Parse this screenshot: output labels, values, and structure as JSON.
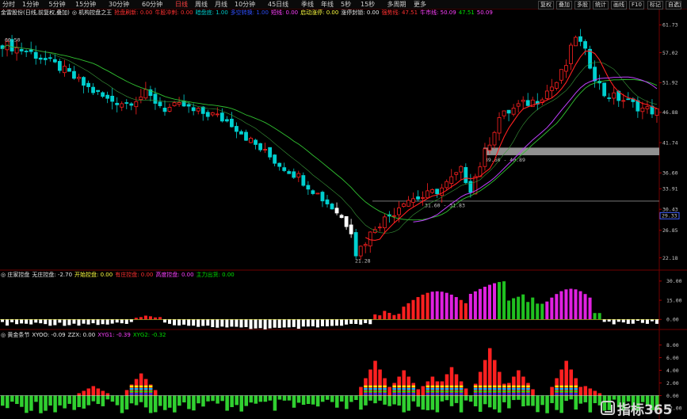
{
  "toolbar": {
    "periods": [
      "分时",
      "1分钟",
      "5分钟",
      "15分钟",
      "30分钟",
      "60分钟",
      "日线",
      "周线",
      "月线",
      "10分钟",
      "45日线",
      "季线",
      "年线",
      "5秒",
      "15秒",
      "多周期",
      "更多"
    ],
    "active_period": "日线",
    "right_buttons": [
      "复权",
      "叠加",
      "多股",
      "统计",
      "画线",
      "F10",
      "标记",
      "自选"
    ]
  },
  "main_header": {
    "items": [
      {
        "text": "金雷股份(日线,前复权,叠加)",
        "color": "#e8e8e8"
      },
      {
        "text": "◎ 机构控盘之王",
        "color": "#e8e8e8"
      },
      {
        "text": "抢盘刷新: 0.00",
        "color": "#ff3030"
      },
      {
        "text": "牛股冲刺: 0.00",
        "color": "#ff3030"
      },
      {
        "text": "暗盘底: 1.00",
        "color": "#00c8c8"
      },
      {
        "text": "多空转换: 1.00",
        "color": "#3050ff"
      },
      {
        "text": "短线: 0.00",
        "color": "#ff40ff"
      },
      {
        "text": "启动涨停: 0.00",
        "color": "#ffff40"
      },
      {
        "text": "涨停封锁: 0.00",
        "color": "#e8e8e8"
      },
      {
        "text": "强势线: 47.51",
        "color": "#ff3030"
      },
      {
        "text": "牛市线: 50.09",
        "color": "#ff40ff"
      },
      {
        "text": "47.51",
        "color": "#00e000"
      },
      {
        "text": "50.09",
        "color": "#ff40ff"
      }
    ]
  },
  "ind1_header": {
    "items": [
      {
        "text": "◎ 庄家控盘",
        "color": "#e8e8e8"
      },
      {
        "text": "无庄控盘: -2.70",
        "color": "#e8e8e8"
      },
      {
        "text": "开始控盘: 0.00",
        "color": "#ffff40"
      },
      {
        "text": "有庄控盘: 0.00",
        "color": "#ff3030"
      },
      {
        "text": "高度控盘: 0.00",
        "color": "#ff40ff"
      },
      {
        "text": "主力出货: 0.00",
        "color": "#00e000"
      }
    ]
  },
  "ind2_header": {
    "items": [
      {
        "text": "◎ 黄金条节",
        "color": "#e8e8e8"
      },
      {
        "text": "XYOO: -0.09",
        "color": "#e8e8e8"
      },
      {
        "text": "ZZX: 0.00",
        "color": "#e8e8e8"
      },
      {
        "text": "XYG1: -0.39",
        "color": "#ff40ff"
      },
      {
        "text": "XYG2: -0.32",
        "color": "#00e000"
      }
    ]
  },
  "main_axis": {
    "labels": [
      "61.73",
      "57.02",
      "51.92",
      "46.88",
      "41.74",
      "36.60",
      "33.91",
      "30.43",
      "26.85",
      "22.18"
    ],
    "ylim": [
      20.5,
      63.0
    ]
  },
  "ind1_axis": {
    "labels": [
      "30.00",
      "15.00",
      "0.00"
    ],
    "ylim": [
      -6.0,
      33.0
    ]
  },
  "ind2_axis": {
    "labels": [
      "8.00",
      "6.00",
      "4.00",
      "2.00",
      "0.00",
      "-2.00"
    ],
    "ylim": [
      -3.2,
      9.2
    ]
  },
  "price_tag": {
    "text": "29.33",
    "color": "#4060ff"
  },
  "annotations": {
    "high_label": "60.50",
    "low_label": "21.28",
    "gap_label": "39.60 - 40.89",
    "gap2_label": "31.60 - 31.83"
  },
  "watermark": {
    "text": "指标365"
  },
  "colors": {
    "up": "#ff2020",
    "down": "#00d0d0",
    "ma_strong": "#ff2020",
    "ma_bull": "#c040ff",
    "ma_green": "#30c030",
    "white": "#ffffff"
  }
}
